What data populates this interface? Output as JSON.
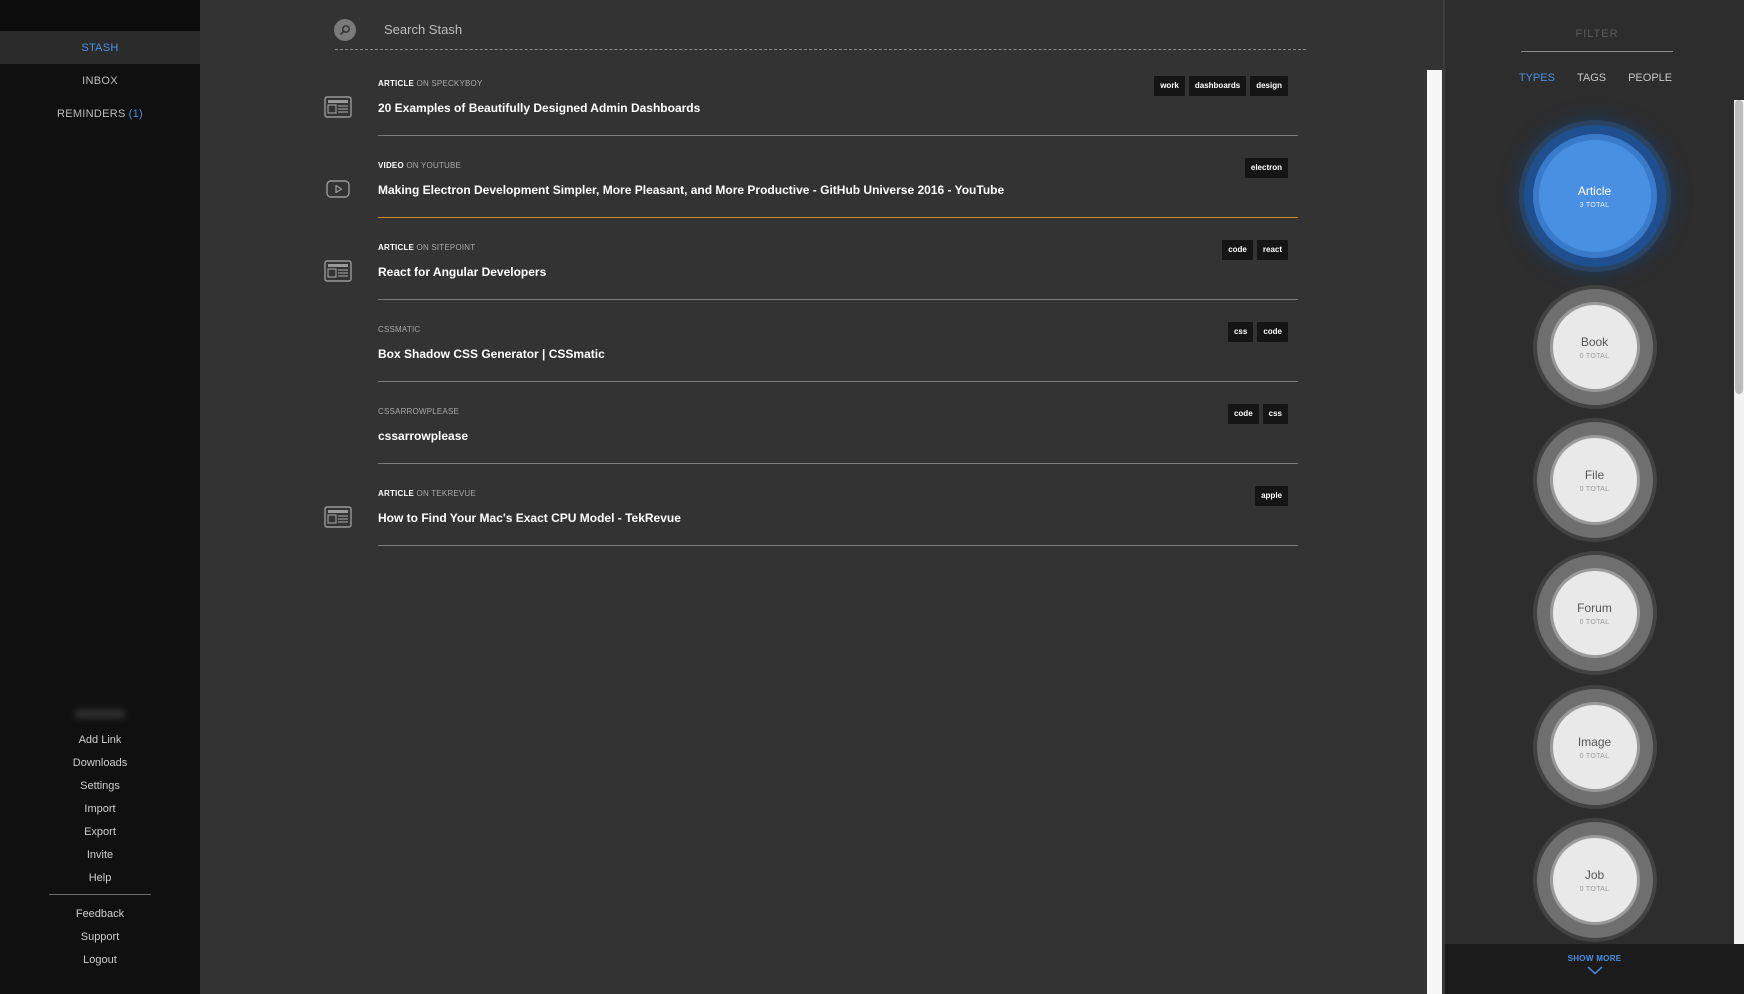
{
  "sidebar": {
    "nav": [
      {
        "label": "STASH",
        "active": true
      },
      {
        "label": "INBOX",
        "active": false
      },
      {
        "label": "REMINDERS",
        "count": "(1)",
        "active": false
      }
    ],
    "links": [
      "Add Link",
      "Downloads",
      "Settings",
      "Import",
      "Export",
      "Invite",
      "Help"
    ],
    "footer_links": [
      "Feedback",
      "Support",
      "Logout"
    ]
  },
  "search": {
    "placeholder": "Search Stash",
    "icon": "search-icon"
  },
  "items": [
    {
      "kind": "ARTICLE",
      "source": "ON SPECKYBOY",
      "title": "20 Examples of Beautifully Designed Admin Dashboards",
      "tags": [
        "work",
        "dashboards",
        "design"
      ],
      "icon": "article-icon"
    },
    {
      "kind": "VIDEO",
      "source": "ON YOUTUBE",
      "title": "Making Electron Development Simpler, More Pleasant, and More Productive - GitHub Universe 2016 - YouTube",
      "tags": [
        "electron"
      ],
      "icon": "video-icon",
      "highlight": true
    },
    {
      "kind": "ARTICLE",
      "source": "ON SITEPOINT",
      "title": "React for Angular Developers",
      "tags": [
        "code",
        "react"
      ],
      "icon": "article-icon"
    },
    {
      "kind": "",
      "source": "CSSMATIC",
      "title": "Box Shadow CSS Generator | CSSmatic",
      "tags": [
        "css",
        "code"
      ],
      "icon": ""
    },
    {
      "kind": "",
      "source": "CSSARROWPLEASE",
      "title": "cssarrowplease",
      "tags": [
        "code",
        "css"
      ],
      "icon": ""
    },
    {
      "kind": "ARTICLE",
      "source": "ON TEKREVUE",
      "title": "How to Find Your Mac's Exact CPU Model - TekRevue",
      "tags": [
        "apple"
      ],
      "icon": "article-icon"
    }
  ],
  "filter": {
    "placeholder": "FILTER",
    "tabs": [
      {
        "label": "TYPES",
        "active": true
      },
      {
        "label": "TAGS",
        "active": false
      },
      {
        "label": "PEOPLE",
        "active": false
      }
    ],
    "types": [
      {
        "name": "Article",
        "count": "3 TOTAL",
        "active": true
      },
      {
        "name": "Book",
        "count": "0 TOTAL",
        "active": false
      },
      {
        "name": "File",
        "count": "0 TOTAL",
        "active": false
      },
      {
        "name": "Forum",
        "count": "0 TOTAL",
        "active": false
      },
      {
        "name": "Image",
        "count": "0 TOTAL",
        "active": false
      },
      {
        "name": "Job",
        "count": "0 TOTAL",
        "active": false
      }
    ],
    "show_more": "SHOW MORE"
  },
  "colors": {
    "accent": "#4a90e2",
    "highlight": "#c8901e",
    "background": "#333333",
    "sidebar": "#101010"
  }
}
